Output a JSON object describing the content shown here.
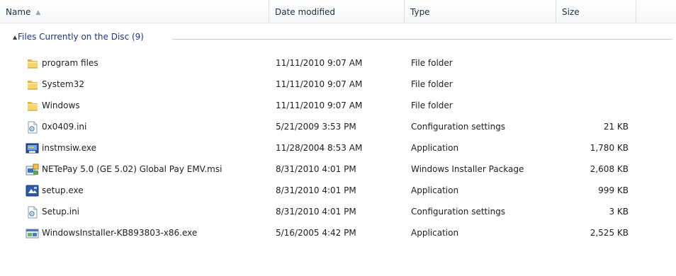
{
  "columns": {
    "name": "Name",
    "date": "Date modified",
    "type": "Type",
    "size": "Size"
  },
  "group": {
    "label": "Files Currently on the Disc (9)"
  },
  "files": [
    {
      "name": "program files",
      "date": "11/11/2010 9:07 AM",
      "type": "File folder",
      "size": "",
      "icon": "folder-icon"
    },
    {
      "name": "System32",
      "date": "11/11/2010 9:07 AM",
      "type": "File folder",
      "size": "",
      "icon": "folder-icon"
    },
    {
      "name": "Windows",
      "date": "11/11/2010 9:07 AM",
      "type": "File folder",
      "size": "",
      "icon": "folder-icon"
    },
    {
      "name": "0x0409.ini",
      "date": "5/21/2009 3:53 PM",
      "type": "Configuration settings",
      "size": "21 KB",
      "icon": "settings-file-icon"
    },
    {
      "name": "instmsiw.exe",
      "date": "11/28/2004 8:53 AM",
      "type": "Application",
      "size": "1,780 KB",
      "icon": "installer-app-icon"
    },
    {
      "name": "NETePay 5.0 (GE 5.02) Global Pay EMV.msi",
      "date": "8/31/2010 4:01 PM",
      "type": "Windows Installer Package",
      "size": "2,608 KB",
      "icon": "msi-package-icon"
    },
    {
      "name": "setup.exe",
      "date": "8/31/2010 4:01 PM",
      "type": "Application",
      "size": "999 KB",
      "icon": "setup-app-icon"
    },
    {
      "name": "Setup.ini",
      "date": "8/31/2010 4:01 PM",
      "type": "Configuration settings",
      "size": "3 KB",
      "icon": "settings-file-icon"
    },
    {
      "name": "WindowsInstaller-KB893803-x86.exe",
      "date": "5/16/2005 4:42 PM",
      "type": "Application",
      "size": "2,525 KB",
      "icon": "windows-installer-app-icon"
    }
  ]
}
